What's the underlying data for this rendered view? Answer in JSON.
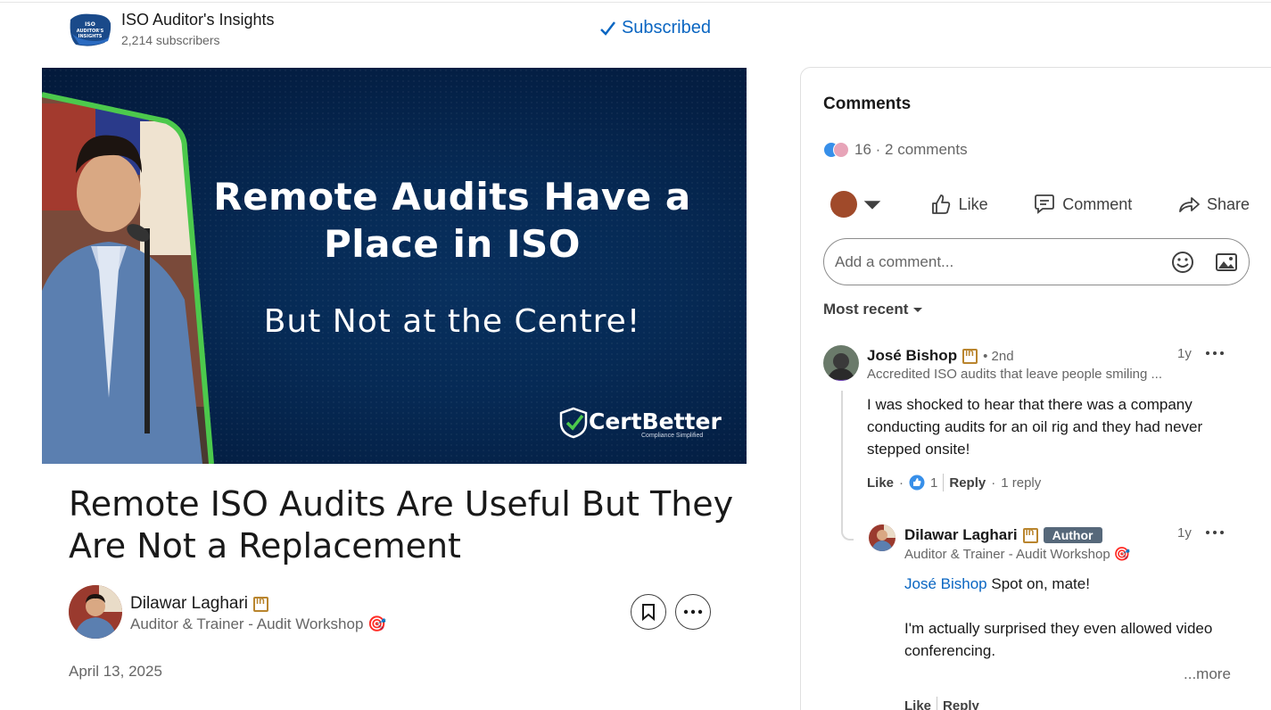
{
  "newsletter": {
    "title": "ISO Auditor's Insights",
    "subscribers": "2,214 subscribers",
    "subscribed_label": "Subscribed",
    "logo_text": "ISO AUDITOR'S INSIGHTS"
  },
  "hero": {
    "headline": "Remote Audits Have a Place in ISO",
    "subheadline": "But Not at the Centre!",
    "brand": "CertBetter",
    "brand_tagline": "Compliance Simplified"
  },
  "article": {
    "title": "Remote ISO Audits Are Useful But They Are Not a Replacement",
    "author_name": "Dilawar Laghari",
    "author_headline": "Auditor & Trainer - Audit Workshop 🎯",
    "date": "April 13, 2025"
  },
  "comments": {
    "heading": "Comments",
    "stats": "16 · 2 comments",
    "actions": {
      "like": "Like",
      "comment": "Comment",
      "share": "Share"
    },
    "input_placeholder": "Add a comment...",
    "sort_label": "Most recent",
    "items": [
      {
        "name": "José Bishop",
        "degree": "• 2nd",
        "headline": "Accredited ISO audits that leave people smiling ...",
        "time": "1y",
        "text": "I was shocked to hear that there was a company conducting audits for an oil rig and they had never stepped onsite!",
        "like_label": "Like",
        "reaction_count": "1",
        "reply_label": "Reply",
        "replies_count": "1 reply"
      },
      {
        "name": "Dilawar Laghari",
        "badge": "Author",
        "headline": "Auditor & Trainer - Audit Workshop 🎯",
        "time": "1y",
        "mention": "José Bishop",
        "text_1": "Spot on, mate!",
        "text_2": "I'm actually surprised they even allowed video conferencing.",
        "more_label": "...more",
        "like_label": "Like",
        "reply_label": "Reply"
      }
    ]
  },
  "colors": {
    "brand_blue": "#0a66c2",
    "hero_navy": "#062a55",
    "hero_accent_green": "#4cc94c",
    "author_badge": "#56687a"
  }
}
